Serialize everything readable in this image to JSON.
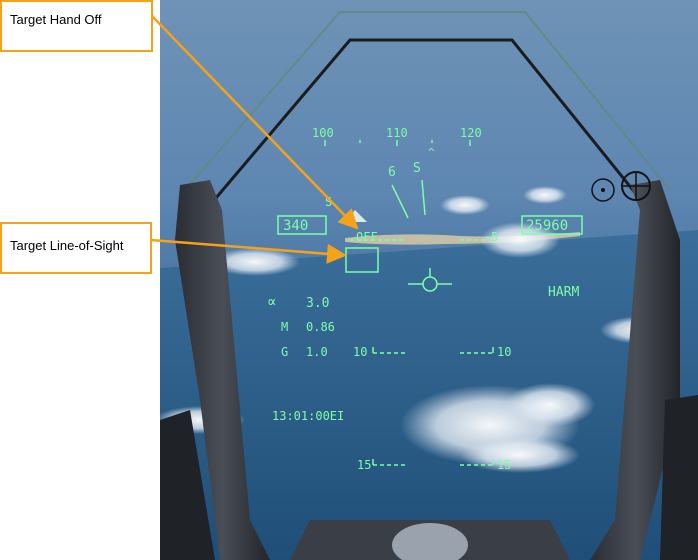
{
  "callouts": {
    "handoff_label": "Target Hand Off",
    "los_label": "Target Line-of-Sight"
  },
  "hud": {
    "heading_ticks": [
      "100",
      "110",
      "120"
    ],
    "heading_caret": "^",
    "pitch_marks": [
      "6",
      "S"
    ],
    "left_marker": "S",
    "airspeed": "340",
    "altitude": "25960",
    "handoff_text": "OFF",
    "ladder_top_right": "5",
    "weapon": "HARM",
    "alpha_symbol": "∝",
    "alpha_value": "3.0",
    "mach_label": "M",
    "mach_value": "0.86",
    "g_label": "G",
    "g_value": "1.0",
    "ladder_10_left": "10",
    "ladder_10_right": "10",
    "time": "13:01:00EI",
    "ladder_15_left": "15",
    "ladder_15_right": "15"
  },
  "colors": {
    "hud_green": "#7dffa8",
    "callout_border": "#f5a21b",
    "callout_arrow": "#f5a21b"
  }
}
